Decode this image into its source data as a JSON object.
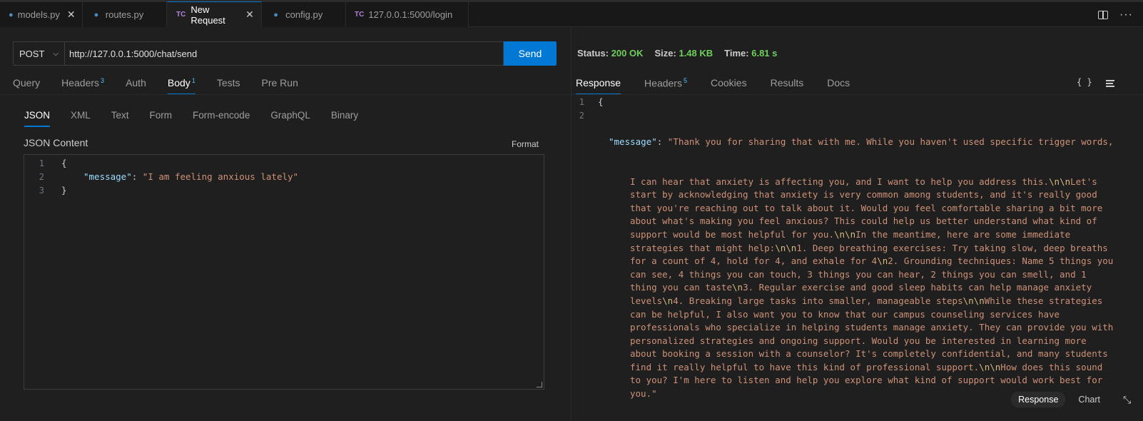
{
  "tabs": [
    {
      "label": "models.py",
      "icon": "python-icon",
      "kind": "py",
      "close": true
    },
    {
      "label": "routes.py",
      "icon": "python-icon",
      "kind": "py",
      "close": false
    },
    {
      "label": "New Request",
      "icon": "thunder-client-icon",
      "kind": "tc",
      "close": true,
      "active": true
    },
    {
      "label": "config.py",
      "icon": "python-icon",
      "kind": "py",
      "close": false
    },
    {
      "label": "127.0.0.1:5000/login",
      "icon": "thunder-client-icon",
      "kind": "tc",
      "close": false
    }
  ],
  "tab_icons": {
    "py": "●",
    "tc": "TC",
    "close": "✕"
  },
  "request": {
    "method": "POST",
    "url": "http://127.0.0.1:5000/chat/send",
    "send_label": "Send"
  },
  "request_tabs": [
    {
      "label": "Query"
    },
    {
      "label": "Headers",
      "badge": "3"
    },
    {
      "label": "Auth"
    },
    {
      "label": "Body",
      "badge": "1",
      "active": true
    },
    {
      "label": "Tests"
    },
    {
      "label": "Pre Run"
    }
  ],
  "body_tabs": [
    "JSON",
    "XML",
    "Text",
    "Form",
    "Form-encode",
    "GraphQL",
    "Binary"
  ],
  "body": {
    "label": "JSON Content",
    "format_label": "Format",
    "lines": [
      {
        "n": "1",
        "open": "{"
      },
      {
        "n": "2",
        "key": "\"message\"",
        "sep": ": ",
        "value": "\"I am feeling anxious lately\""
      },
      {
        "n": "3",
        "close": "}"
      }
    ]
  },
  "response": {
    "status_label": "Status:",
    "status_value": "200 OK",
    "size_label": "Size:",
    "size_value": "1.48 KB",
    "time_label": "Time:",
    "time_value": "6.81 s",
    "tabs": [
      {
        "label": "Response",
        "active": true
      },
      {
        "label": "Headers",
        "badge": "5"
      },
      {
        "label": "Cookies"
      },
      {
        "label": "Results"
      },
      {
        "label": "Docs"
      }
    ],
    "braces_icon": "{ }",
    "line1": "{",
    "line3": "}",
    "key": "\"message\"",
    "sep": ": ",
    "wrapped": [
      "\"Thank you for sharing that with me. While you haven't used specific trigger words,",
      "I can hear that anxiety is affecting you, and I want to help you address this.\\n\\nLet's",
      "start by acknowledging that anxiety is very common among students, and it's really good",
      "that you're reaching out to talk about it. Would you feel comfortable sharing a bit more",
      "about what's making you feel anxious? This could help us better understand what kind of",
      "support would be most helpful for you.\\n\\nIn the meantime, here are some immediate",
      "strategies that might help:\\n\\n1. Deep breathing exercises: Try taking slow, deep breaths",
      "for a count of 4, hold for 4, and exhale for 4\\n2. Grounding techniques: Name 5 things you",
      "can see, 4 things you can touch, 3 things you can hear, 2 things you can smell, and 1",
      "thing you can taste\\n3. Regular exercise and good sleep habits can help manage anxiety",
      "levels\\n4. Breaking large tasks into smaller, manageable steps\\n\\nWhile these strategies",
      "can be helpful, I also want you to know that our campus counseling services have",
      "professionals who specialize in helping students manage anxiety. They can provide you with",
      "personalized strategies and ongoing support. Would you be interested in learning more",
      "about booking a session with a counselor? It's completely confidential, and many students",
      "find it really helpful to have this kind of professional support.\\n\\nHow does this sound",
      "to you? I'm here to listen and help you explore what kind of support would work best for",
      "you.\""
    ],
    "view_response": "Response",
    "view_chart": "Chart",
    "expand_icon": "⤡"
  },
  "colors": {
    "accent": "#0078d4",
    "status_ok": "#6fcf5c",
    "json_key": "#9cdcfe",
    "json_string": "#ce9178",
    "json_escape": "#d7ba7d"
  }
}
